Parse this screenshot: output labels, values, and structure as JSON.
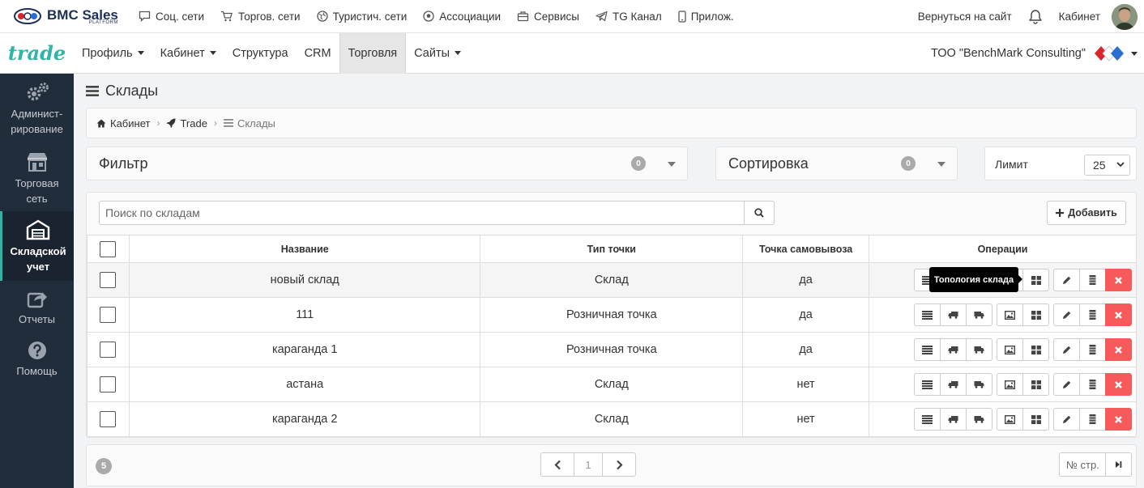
{
  "topbar": {
    "brand_name": "BMC Sales",
    "brand_sub": "PLATFORM",
    "links": [
      {
        "label": "Соц. сети",
        "icon": "chat-icon"
      },
      {
        "label": "Торгов. сети",
        "icon": "cart-icon"
      },
      {
        "label": "Туристич. сети",
        "icon": "globe-icon"
      },
      {
        "label": "Ассоциации",
        "icon": "soccer-ball-icon"
      },
      {
        "label": "Сервисы",
        "icon": "briefcase-icon"
      },
      {
        "label": "TG Канал",
        "icon": "telegram-icon"
      },
      {
        "label": "Прилож.",
        "icon": "mobile-icon"
      }
    ],
    "back_to_site": "Вернуться на сайт",
    "cabinet": "Кабинет"
  },
  "secbar": {
    "logo": "trade",
    "nav": [
      {
        "label": "Профиль",
        "dropdown": true
      },
      {
        "label": "Кабинет",
        "dropdown": true
      },
      {
        "label": "Структура",
        "dropdown": false
      },
      {
        "label": "CRM",
        "dropdown": false
      },
      {
        "label": "Торговля",
        "dropdown": false,
        "active": true
      },
      {
        "label": "Сайты",
        "dropdown": true
      }
    ],
    "company": "ТОО \"BenchMark Consulting\""
  },
  "sidebar": {
    "items": [
      {
        "label": "Админист-\nрирование",
        "icon": "gears-icon"
      },
      {
        "label": "Торговая\nсеть",
        "icon": "shop-icon"
      },
      {
        "label": "Складской\nучет",
        "icon": "warehouse-icon",
        "active": true
      },
      {
        "label": "Отчеты",
        "icon": "share-icon"
      },
      {
        "label": "Помощь",
        "icon": "help-icon"
      }
    ]
  },
  "page": {
    "title": "Склады",
    "breadcrumbs": [
      "Кабинет",
      "Trade",
      "Склады"
    ]
  },
  "filter": {
    "title": "Фильтр",
    "count": "0"
  },
  "sort": {
    "title": "Сортировка",
    "count": "0"
  },
  "limit": {
    "label": "Лимит",
    "value": "25"
  },
  "search": {
    "placeholder": "Поиск по складам"
  },
  "add_button": "Добавить",
  "table": {
    "columns": [
      "Название",
      "Тип точки",
      "Точка самовывоза",
      "Операции"
    ],
    "rows": [
      {
        "name": "новый склад",
        "type": "Склад",
        "pickup": "да"
      },
      {
        "name": "111",
        "type": "Розничная точка",
        "pickup": "да"
      },
      {
        "name": "караганда 1",
        "type": "Розничная точка",
        "pickup": "да"
      },
      {
        "name": "астана",
        "type": "Склад",
        "pickup": "нет"
      },
      {
        "name": "караганда 2",
        "type": "Склад",
        "pickup": "нет"
      }
    ]
  },
  "tooltip": "Топология склада",
  "footer": {
    "total": "5",
    "current_page": "1",
    "goto_placeholder": "№ стр."
  },
  "colors": {
    "sidebar_bg": "#222d3c",
    "accent": "#2eb5a3",
    "delete": "#f65a5b"
  }
}
